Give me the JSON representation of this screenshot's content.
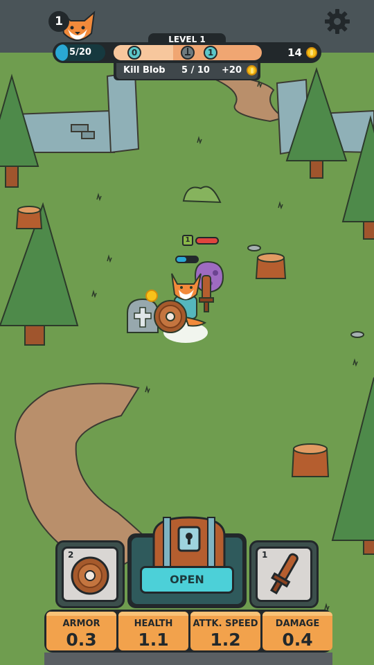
{
  "player": {
    "level_badge": "1",
    "xp_text": "5/20",
    "xp_fraction": 0.25
  },
  "header": {
    "level_label": "LEVEL 1",
    "stage_markers": [
      "0",
      "",
      "1"
    ],
    "coins": "14"
  },
  "quest": {
    "name": "Kill Blob",
    "progress": "5 / 10",
    "reward": "+20"
  },
  "world": {
    "enemy_level": "1",
    "enemy_health_fraction": 1.0,
    "player_health_fraction": 0.45
  },
  "inventory": {
    "left_slot_count": "2",
    "left_slot_item": "wooden-shield",
    "right_slot_count": "1",
    "right_slot_item": "wooden-sword",
    "open_label": "OPEN"
  },
  "stats": [
    {
      "label": "ARMOR",
      "value": "0.3"
    },
    {
      "label": "HEALTH",
      "value": "1.1"
    },
    {
      "label": "ATTK. SPEED",
      "value": "1.2"
    },
    {
      "label": "DAMAGE",
      "value": "0.4"
    }
  ],
  "colors": {
    "grass": "#6f9d4f",
    "hud_dark": "#22282b",
    "accent_cyan": "#4cd0d8",
    "stat_orange": "#f2a24c",
    "coin_gold": "#f7c21b"
  }
}
